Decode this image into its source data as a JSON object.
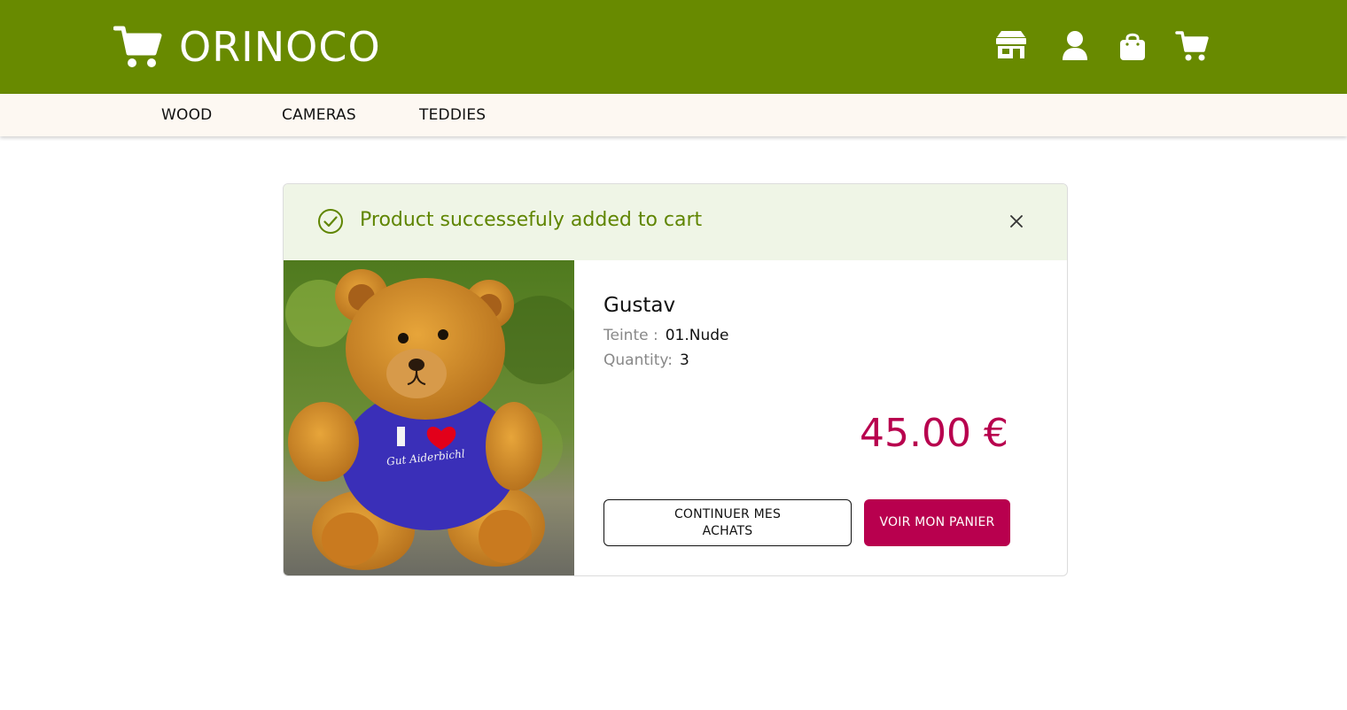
{
  "header": {
    "brand_name": "ORINOCO",
    "icons": [
      "cart-logo-icon",
      "store-icon",
      "user-icon",
      "bag-icon",
      "cart-icon"
    ]
  },
  "nav": {
    "items": [
      {
        "label": "WOOD"
      },
      {
        "label": "CAMERAS"
      },
      {
        "label": "TEDDIES"
      }
    ]
  },
  "modal": {
    "alert_text": "Product successefuly added to cart",
    "product": {
      "name": "Gustav",
      "shade_label": "Teinte :",
      "shade_value": "01.Nude",
      "quantity_label": "Quantity:",
      "quantity_value": "3",
      "price": "45.00 €",
      "image_shirt_text": "Gut Aiderbichl"
    },
    "buttons": {
      "continue": "CONTINUER MES ACHATS",
      "view_cart": "VOIR MON PANIER"
    }
  },
  "colors": {
    "header_bg": "#688a00",
    "nav_bg": "#fdf8f2",
    "alert_bg": "#eff5e6",
    "alert_text": "#5f8500",
    "accent": "#b8004e"
  }
}
